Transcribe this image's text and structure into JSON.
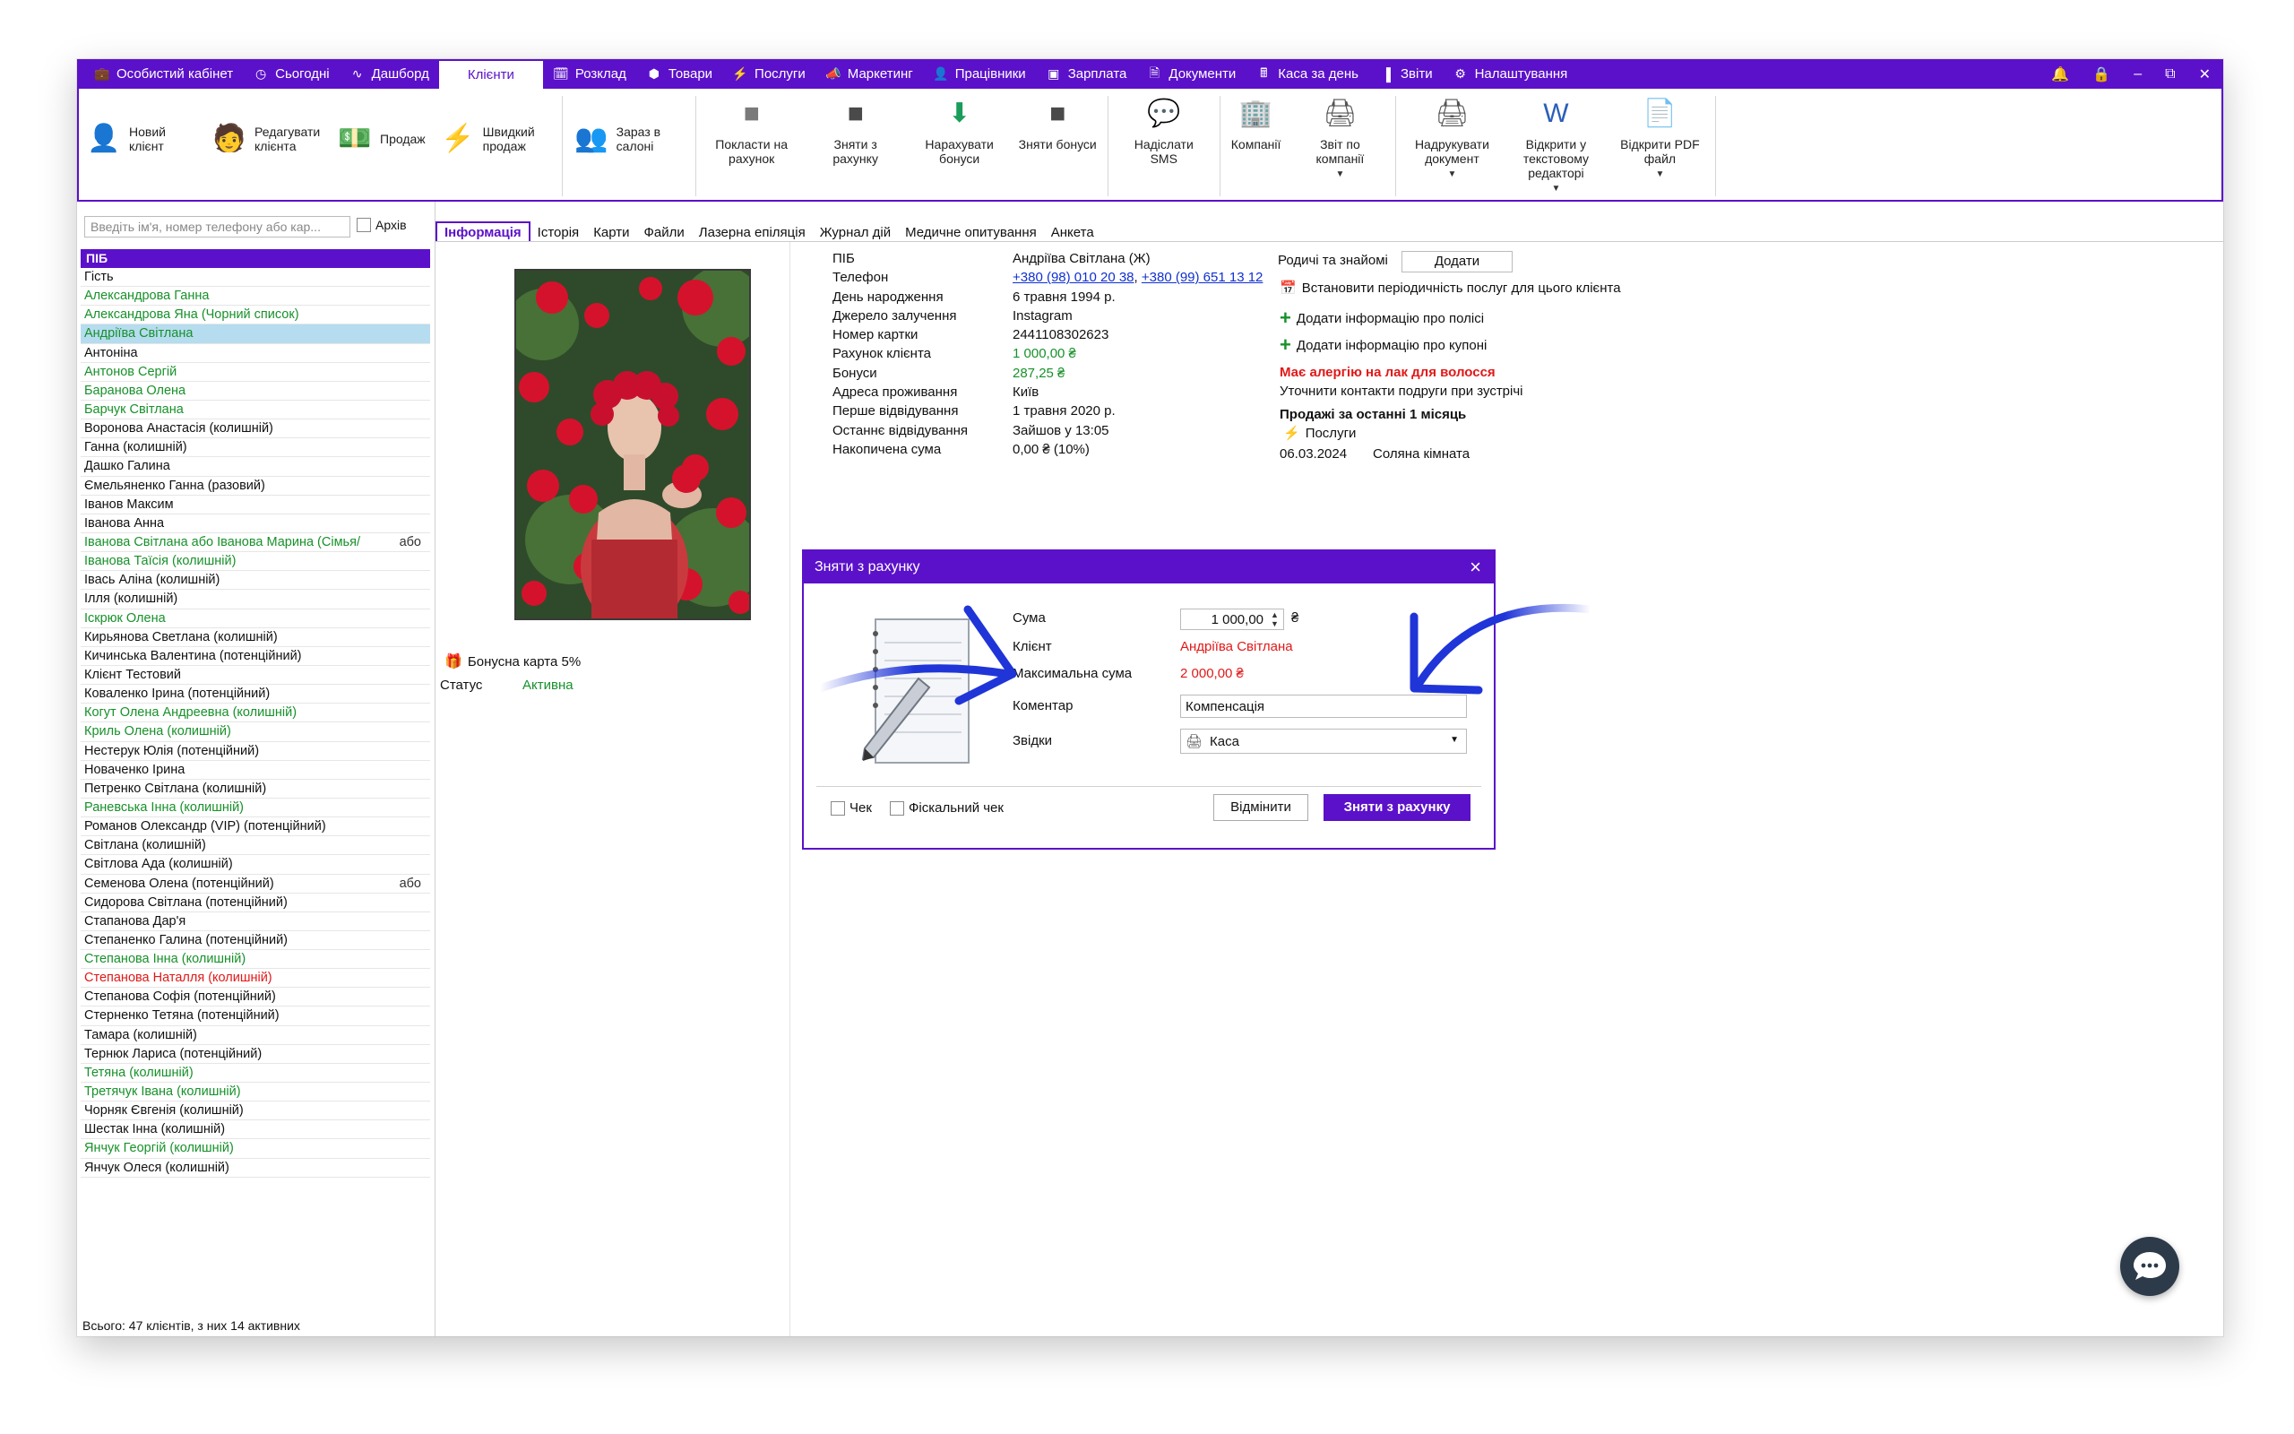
{
  "menu": [
    {
      "label": "Особистий кабінет",
      "icon": "briefcase-icon"
    },
    {
      "label": "Сьогодні",
      "icon": "clock-icon"
    },
    {
      "label": "Дашборд",
      "icon": "pulse-icon"
    },
    {
      "label": "Клієнти",
      "icon": "",
      "active": true
    },
    {
      "label": "Розклад",
      "icon": "calendar-icon"
    },
    {
      "label": "Товари",
      "icon": "box-icon"
    },
    {
      "label": "Послуги",
      "icon": "lightning-icon"
    },
    {
      "label": "Маркетинг",
      "icon": "megaphone-icon"
    },
    {
      "label": "Працівники",
      "icon": "person-icon"
    },
    {
      "label": "Зарплата",
      "icon": "money-icon"
    },
    {
      "label": "Документи",
      "icon": "document-icon"
    },
    {
      "label": "Каса за день",
      "icon": "calculator-icon"
    },
    {
      "label": "Звіти",
      "icon": "bar-chart-icon"
    },
    {
      "label": "Налаштування",
      "icon": "gear-icon"
    }
  ],
  "ribbon": [
    {
      "label": "Новий клієнт",
      "icon": "new-client-icon",
      "layout": "h"
    },
    {
      "label": "Редагувати клієнта",
      "icon": "edit-client-icon",
      "layout": "h"
    },
    {
      "label": "Продаж",
      "icon": "sale-icon",
      "layout": "h"
    },
    {
      "label": "Швидкий продаж",
      "icon": "quick-sale-icon",
      "layout": "h",
      "sep": true
    },
    {
      "label": "Зараз в салоні",
      "icon": "in-salon-icon",
      "layout": "h",
      "sep": true
    },
    {
      "label": "Покласти на рахунок",
      "icon": "deposit-icon"
    },
    {
      "label": "Зняти з рахунку",
      "icon": "withdraw-icon"
    },
    {
      "label": "Нарахувати бонуси",
      "icon": "add-bonus-icon"
    },
    {
      "label": "Зняти бонуси",
      "icon": "remove-bonus-icon",
      "sep": true
    },
    {
      "label": "Надіслати SMS",
      "icon": "sms-icon",
      "sep": true
    },
    {
      "label": "Компанії",
      "icon": "companies-icon"
    },
    {
      "label": "Звіт по компанії",
      "icon": "company-report-icon",
      "dropdown": true,
      "sep": true
    },
    {
      "label": "Надрукувати документ",
      "icon": "print-icon",
      "dropdown": true
    },
    {
      "label": "Відкрити у текстовому редакторі",
      "icon": "word-icon",
      "dropdown": true
    },
    {
      "label": "Відкрити PDF файл",
      "icon": "pdf-icon",
      "dropdown": true,
      "sep": true
    }
  ],
  "search": {
    "placeholder": "Введіть ім'я, номер телефону або кар...",
    "archive_label": "Архів"
  },
  "list": {
    "header": "ПІБ",
    "total": "Всього: 47 клієнтів, з них 14 активних"
  },
  "clients": [
    {
      "name": "Гість",
      "color": "black"
    },
    {
      "name": "Александрова Ганна",
      "color": "green"
    },
    {
      "name": "Александрова Яна (Чорний список)",
      "color": "green"
    },
    {
      "name": "Андріїва Світлана",
      "color": "green",
      "selected": true
    },
    {
      "name": "Антоніна",
      "color": "black"
    },
    {
      "name": "Антонов Сергій",
      "color": "green"
    },
    {
      "name": "Баранова Олена",
      "color": "green"
    },
    {
      "name": "Барчук Світлана",
      "color": "green"
    },
    {
      "name": "Воронова Анастасія (колишній)",
      "color": "black"
    },
    {
      "name": "Ганна (колишній)",
      "color": "black"
    },
    {
      "name": "Дашко Галина",
      "color": "black"
    },
    {
      "name": "Ємельяненко Ганна (разовий)",
      "color": "black"
    },
    {
      "name": "Іванов Максим",
      "color": "black"
    },
    {
      "name": "Іванова Анна",
      "color": "black"
    },
    {
      "name": "Іванова Світлана або Іванова Марина (Сімья/",
      "color": "green",
      "extra": "або"
    },
    {
      "name": "Іванова Таїсія (колишній)",
      "color": "green"
    },
    {
      "name": "Івась Аліна (колишній)",
      "color": "black"
    },
    {
      "name": "Ілля (колишній)",
      "color": "black"
    },
    {
      "name": "Іскрюк Олена",
      "color": "green"
    },
    {
      "name": "Кирьянова Светлана (колишній)",
      "color": "black"
    },
    {
      "name": "Кичинська Валентина (потенційний)",
      "color": "black"
    },
    {
      "name": "Клієнт Тестовий",
      "color": "black"
    },
    {
      "name": "Коваленко Ірина (потенційний)",
      "color": "black"
    },
    {
      "name": "Когут Олена Андреевна (колишній)",
      "color": "green"
    },
    {
      "name": "Криль Олена (колишній)",
      "color": "green"
    },
    {
      "name": "Нестерук Юлія (потенційний)",
      "color": "black"
    },
    {
      "name": "Новаченко Ірина",
      "color": "black"
    },
    {
      "name": "Петренко Світлана (колишній)",
      "color": "black"
    },
    {
      "name": "Раневська Інна (колишній)",
      "color": "green"
    },
    {
      "name": "Романов Олександр (VIP) (потенційний)",
      "color": "black"
    },
    {
      "name": "Світлана (колишній)",
      "color": "black"
    },
    {
      "name": "Світлова Ада (колишній)",
      "color": "black"
    },
    {
      "name": "Семенова Олена (потенційний)",
      "color": "black",
      "extra": "або"
    },
    {
      "name": "Сидорова Світлана (потенційний)",
      "color": "black"
    },
    {
      "name": "Стапанова Дар'я",
      "color": "black"
    },
    {
      "name": "Степаненко Галина (потенційний)",
      "color": "black"
    },
    {
      "name": "Степанова Інна (колишній)",
      "color": "green"
    },
    {
      "name": "Степанова Наталля (колишній)",
      "color": "red"
    },
    {
      "name": "Степанова Софія (потенційний)",
      "color": "black"
    },
    {
      "name": "Стерненко Тетяна (потенційний)",
      "color": "black"
    },
    {
      "name": "Тамара (колишній)",
      "color": "black"
    },
    {
      "name": "Тернюк Лариса (потенційний)",
      "color": "black"
    },
    {
      "name": "Тетяна (колишній)",
      "color": "green"
    },
    {
      "name": "Третячук Івана (колишній)",
      "color": "green"
    },
    {
      "name": "Чорняк Євгенія (колишній)",
      "color": "black"
    },
    {
      "name": "Шестак Інна (колишній)",
      "color": "black"
    },
    {
      "name": "Янчук Георгій (колишній)",
      "color": "green"
    },
    {
      "name": "Янчук Олеся (колишній)",
      "color": "black"
    }
  ],
  "tabs": [
    "Інформація",
    "Історія",
    "Карти",
    "Файли",
    "Лазерна епіляція",
    "Журнал дій",
    "Медичне опитування",
    "Анкета"
  ],
  "profile": {
    "bonus_card": "Бонусна карта 5%",
    "status_label": "Статус",
    "status_value": "Активна",
    "labels": [
      "ПІБ",
      "Телефон",
      "День народження",
      "Джерело залучення",
      "Номер картки",
      "Рахунок клієнта",
      "Бонуси",
      "Адреса проживання",
      "Перше відвідування",
      "Останнє відвідування",
      "Накопичена сума"
    ],
    "name": "Андріїва Світлана (Ж)",
    "phone1": "+380 (98) 010 20 38",
    "phone_sep": ",",
    "phone2": "+380 (99) 651 13 12",
    "birthday": "6 травня 1994 р.",
    "source": "Instagram",
    "card_number": "2441108302623",
    "balance": "1 000,00 ₴",
    "bonuses": "287,25 ₴",
    "address": "Київ",
    "first_visit": "1 травня 2020 р.",
    "last_visit": "Зайшов у 13:05",
    "accumulated": "0,00 ₴ (10%)"
  },
  "side": {
    "relatives_label": "Родичі та знайомі",
    "add_button": "Додати",
    "periodicity": "Встановити періодичність послуг для цього клієнта",
    "add_policy": "Додати інформацію про полісі",
    "add_coupon": "Додати інформацію про купоні",
    "allergy": "Має алергію на лак для волосся",
    "note": "Уточнити контакти подруги при зустрічі",
    "sales_title": "Продажі за останні 1 місяць",
    "services_label": "Послуги",
    "sale_date": "06.03.2024",
    "sale_service": "Соляна кімната"
  },
  "dialog": {
    "title": "Зняти з рахунку",
    "sum_label": "Сума",
    "sum_value": "1 000,00",
    "currency": "₴",
    "client_label": "Клієнт",
    "client_value": "Андріїва Світлана",
    "max_label": "Максимальна сума",
    "max_value": "2 000,00 ₴",
    "comment_label": "Коментар",
    "comment_value": "Компенсація",
    "from_label": "Звідки",
    "from_value": "Каса",
    "check_label": "Чек",
    "fiscal_label": "Фіскальний чек",
    "cancel": "Відмінити",
    "submit": "Зняти з рахунку"
  },
  "colors": {
    "accent": "#5b11c9",
    "green": "#17912a",
    "red": "#e21818",
    "link": "#1030d0",
    "annotation_arrow": "#1f35d8"
  }
}
